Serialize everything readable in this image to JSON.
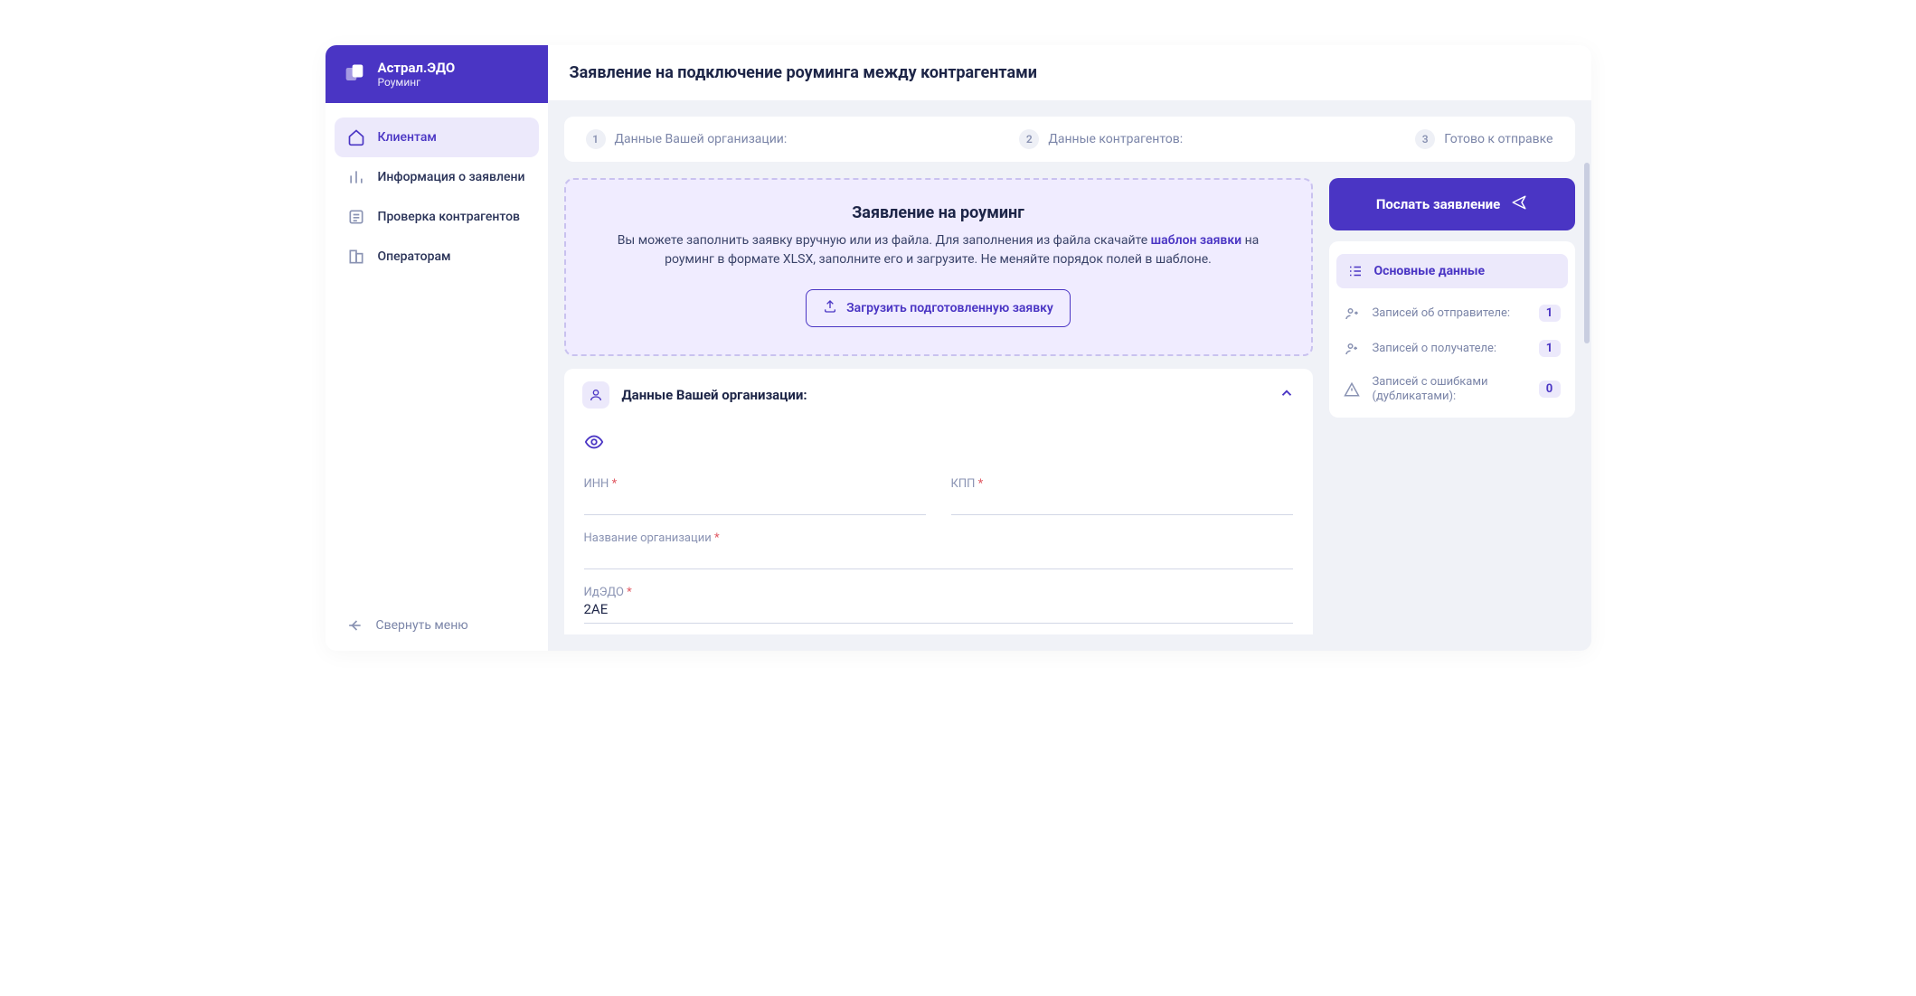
{
  "brand": {
    "title": "Астрал.ЭДО",
    "subtitle": "Роуминг"
  },
  "nav": {
    "items": [
      {
        "label": "Клиентам",
        "active": true
      },
      {
        "label": "Информация о заявлени",
        "active": false
      },
      {
        "label": "Проверка контрагентов",
        "active": false
      },
      {
        "label": "Операторам",
        "active": false
      }
    ],
    "collapse": "Свернуть меню"
  },
  "page_title": "Заявление на подключение роуминга между контрагентами",
  "stepper": {
    "steps": [
      {
        "num": "1",
        "label": "Данные Вашей организации:"
      },
      {
        "num": "2",
        "label": "Данные контрагентов:"
      },
      {
        "num": "3",
        "label": "Готово к отправке"
      }
    ]
  },
  "info": {
    "title": "Заявление на роуминг",
    "text_a": "Вы можете заполнить заявку вручную или из файла. Для заполнения из файла скачайте ",
    "link": "шаблон заявки",
    "text_b": " на роуминг в формате XLSX, заполните его и загрузите. Не меняйте порядок полей в шаблоне.",
    "upload": "Загрузить подготовленную заявку"
  },
  "org": {
    "heading": "Данные Вашей организации:",
    "fields": {
      "inn_label": "ИНН",
      "kpp_label": "КПП",
      "name_label": "Название организации",
      "idedo_label": "ИдЭДО",
      "idedo_value": "2AE"
    }
  },
  "side": {
    "send": "Послать заявление",
    "stats_title": "Основные данные",
    "rows": [
      {
        "label": "Записей об отправителе:",
        "value": "1"
      },
      {
        "label": "Записей о получателе:",
        "value": "1"
      },
      {
        "label": "Записей с ошибками (дубликатами):",
        "value": "0"
      }
    ]
  }
}
